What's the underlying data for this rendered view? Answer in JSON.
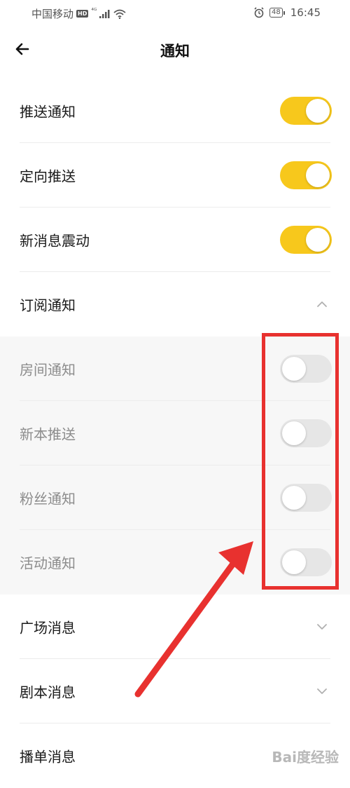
{
  "status_bar": {
    "carrier": "中国移动",
    "hd": "HD",
    "network": "⁴ᴳ",
    "battery": "48",
    "time": "16:45"
  },
  "header": {
    "title": "通知"
  },
  "rows": [
    {
      "label": "推送通知",
      "control": "toggle",
      "state": true
    },
    {
      "label": "定向推送",
      "control": "toggle",
      "state": true
    },
    {
      "label": "新消息震动",
      "control": "toggle",
      "state": true
    },
    {
      "label": "订阅通知",
      "control": "chevron",
      "expanded": true
    }
  ],
  "subscription_items": [
    {
      "label": "房间通知",
      "state": false
    },
    {
      "label": "新本推送",
      "state": false
    },
    {
      "label": "粉丝通知",
      "state": false
    },
    {
      "label": "活动通知",
      "state": false
    }
  ],
  "collapsed_sections": [
    {
      "label": "广场消息",
      "expanded": false
    },
    {
      "label": "剧本消息",
      "expanded": false
    },
    {
      "label": "播单消息",
      "expanded": false
    }
  ],
  "colors": {
    "accent": "#f7c81c",
    "toggle_off": "#e6e6e6",
    "annotation_red": "#e8312f"
  },
  "watermark": {
    "text": "Bai度经验"
  }
}
